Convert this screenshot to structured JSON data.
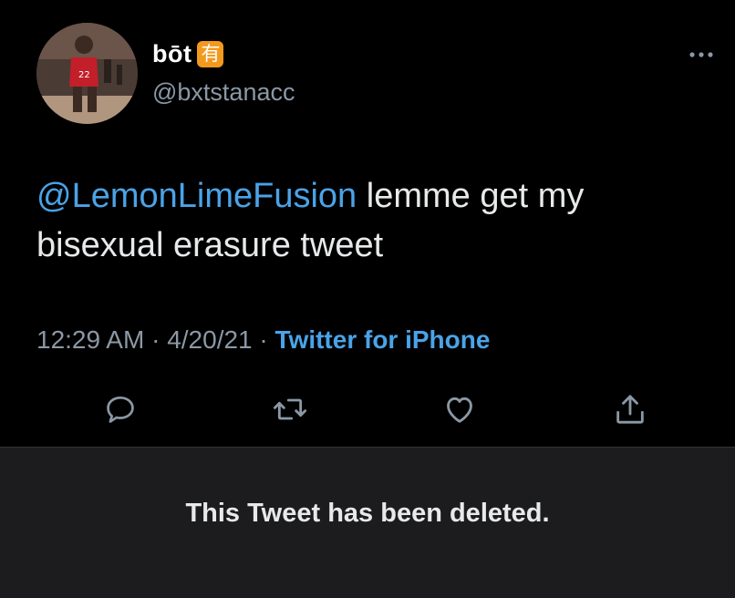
{
  "author": {
    "display_name": "bōt",
    "name_badge": "有",
    "handle": "@bxtstanacc"
  },
  "tweet": {
    "mention": "@LemonLimeFusion",
    "body": " lemme get my bisexual erasure tweet"
  },
  "meta": {
    "time": "12:29 AM",
    "sep1": " · ",
    "date": "4/20/21",
    "sep2": " · ",
    "source": "Twitter for iPhone"
  },
  "icons": {
    "more": "more-icon",
    "reply": "reply-icon",
    "retweet": "retweet-icon",
    "like": "like-icon",
    "share": "share-icon"
  },
  "colors": {
    "background": "#000000",
    "link_blue": "#4aa3e8",
    "muted": "#8b98a5",
    "deleted_bar": "#1c1c1e",
    "badge_orange": "#f39a1e"
  },
  "quoted": {
    "deleted_message": "This Tweet has been deleted."
  }
}
